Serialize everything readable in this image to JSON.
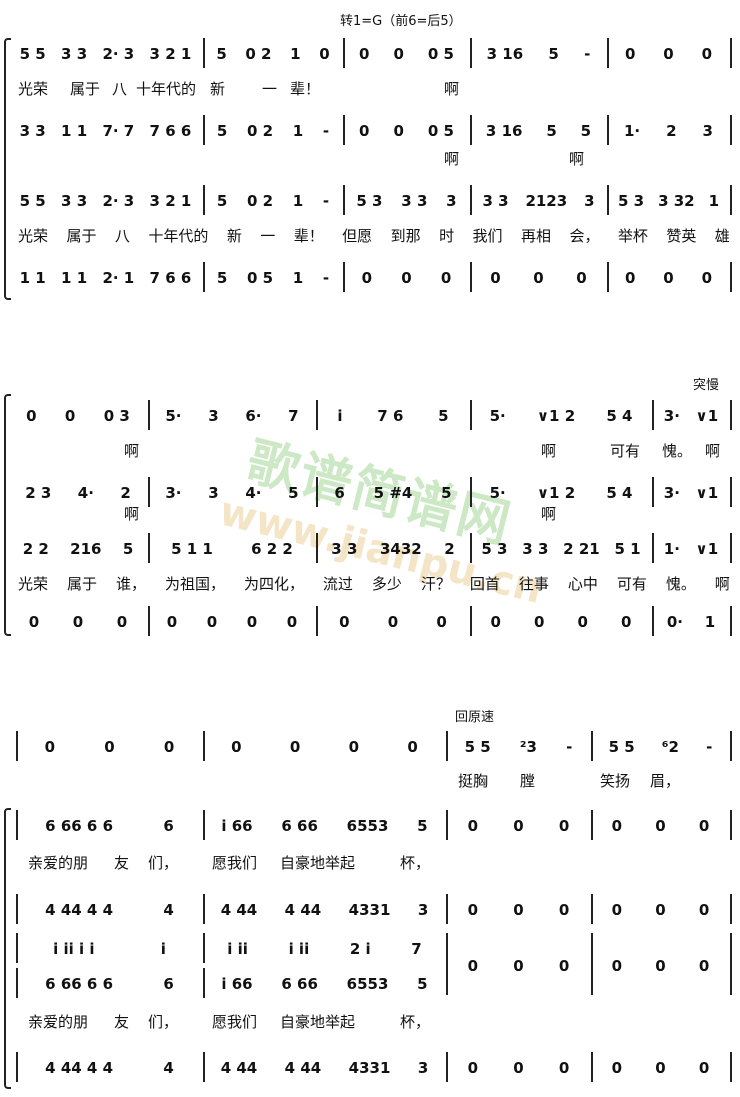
{
  "annotations": {
    "key_change": "转1=G（前6=后5）",
    "slow_down": "突慢",
    "tempo_primo": "回原速"
  },
  "watermark": {
    "text": "歌谱简谱网",
    "url": "www.jianpu.cn"
  },
  "systems": [
    {
      "staves": [
        {
          "measures": [
            "5 5  3 3  2· 3  3 2 1",
            "5  0 2  1  0",
            "0  0  0 5",
            "3 16  5  -",
            "0  0  0"
          ]
        },
        {
          "measures": [
            "3 3  1 1  7· 7  7 6 6",
            "5  0 2  1  -",
            "0  0  0 5",
            "3 16  5  5",
            "1·  2  3"
          ]
        },
        {
          "measures": [
            "5 5  3 3  2· 3  3 2 1",
            "5  0 2  1  -",
            "5 3  3 3  3",
            "3 3  2123  3",
            "5 3  3 32  1"
          ]
        },
        {
          "measures": [
            "1 1  1 1  2· 1  7 6 6",
            "5  0 5  1  -",
            "0  0  0",
            "0  0  0",
            "0  0  0"
          ]
        }
      ],
      "lyrics_sparse": [
        [
          "光荣",
          "属于",
          "八",
          "十年代的",
          "新",
          "一",
          "辈！",
          "啊"
        ],
        [
          "啊",
          "啊"
        ]
      ],
      "lyrics_full": [
        "光荣",
        "属于",
        "八",
        "十年代的",
        "新",
        "一",
        "辈！",
        "但愿",
        "到那",
        "时",
        "我们",
        "再相",
        "会，",
        "举杯",
        "赞英",
        "雄"
      ]
    },
    {
      "staves": [
        {
          "measures": [
            "0  0  0 3",
            "5·  3  6·  7",
            "i  7 6  5",
            "5·  ∨1 2  5 4",
            "3·  ∨1"
          ]
        },
        {
          "measures": [
            "2 3  4·  2",
            "3·  3  4·  5",
            "6  5 #4  5",
            "5·  ∨1 2  5 4",
            "3·  ∨1"
          ]
        },
        {
          "measures": [
            "2 2  216  5",
            "5 1 1  6 2 2",
            "3 3  3432  2",
            "5 3  3 3  2 21  5 1",
            "1·  ∨1"
          ]
        },
        {
          "measures": [
            "0  0  0",
            "0  0  0  0",
            "0  0  0",
            "0  0  0  0",
            "0·  1"
          ]
        }
      ],
      "lyrics_sparse": [
        [
          "啊",
          "啊",
          "可有",
          "愧。",
          "啊"
        ],
        [
          "啊",
          "啊"
        ]
      ],
      "lyrics_full": [
        "光荣",
        "属于",
        "谁，",
        "为祖国，",
        "为四化，",
        "流过",
        "多少",
        "汗？",
        "回首",
        "往事",
        "心中",
        "可有",
        "愧。",
        "啊"
      ]
    },
    {
      "staves": [
        {
          "measures": [
            "0  0  0",
            "0  0  0  0",
            "5 5  ²3  -",
            "5 5  ⁶2  -"
          ]
        },
        {
          "measures": [
            "6 66 6 6  6",
            "i 66  6 66  6553  5",
            "0  0  0",
            "0  0  0"
          ]
        },
        {
          "measures": [
            "4 44 4 4  4",
            "4 44  4 44  4331  3",
            "0  0  0",
            "0  0  0"
          ]
        },
        {
          "measures": [
            "i ii i i  i",
            "i ii  i ii  2 i  7",
            "0  0  0",
            "0  0  0"
          ]
        },
        {
          "measures": [
            "6 66 6 6  6",
            "i 66  6 66  6553  5"
          ]
        },
        {
          "measures": [
            "4 44 4 4  4",
            "4 44  4 44  4331  3",
            "0  0  0",
            "0  0  0"
          ]
        }
      ],
      "lyrics_sparse": [
        [
          "挺胸",
          "膛",
          "笑扬",
          "眉，"
        ],
        [
          "亲爱的朋",
          "友",
          "们，",
          "愿我们",
          "自豪地举起",
          "杯，"
        ],
        [
          "亲爱的朋",
          "友",
          "们，",
          "愿我们",
          "自豪地举起",
          "杯，"
        ]
      ]
    }
  ]
}
